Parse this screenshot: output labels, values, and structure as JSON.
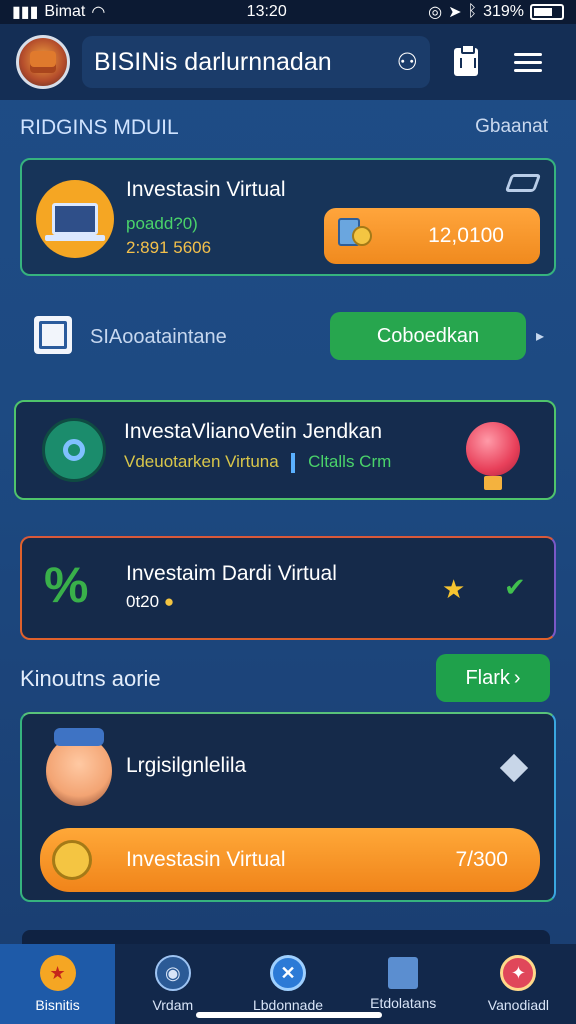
{
  "status_bar": {
    "carrier": "Bimat",
    "time": "13:20",
    "battery": "319%"
  },
  "header": {
    "title": "BISINis darlurnnadan"
  },
  "section_title": {
    "left": "RIDGINS MDUIL",
    "right": "Gbaanat"
  },
  "card1": {
    "title": "Investasin Virtual",
    "sub1": "poadd?0)",
    "sub2": "2:891 5606",
    "button_value": "12,0100"
  },
  "row2": {
    "label": "SIAooataintane",
    "button": "Coboedkan"
  },
  "card2": {
    "title": "InvestaVlianoVetin Jendkan",
    "sub_left": "Vdeuotarken Virtuna",
    "sub_right": "Cltalls Crm"
  },
  "card3": {
    "title": "Investaim Dardi Virtual",
    "sub": "0t20"
  },
  "section2": {
    "title": "Kinoutns aorie",
    "button": "Flark"
  },
  "card4": {
    "title": "Lrgisilgnlelila",
    "button_label": "Investasin Virtual",
    "button_value": "7/300"
  },
  "bottom_nav": [
    {
      "label": "Bisnitis"
    },
    {
      "label": "Vrdam"
    },
    {
      "label": "Lbdonnade"
    },
    {
      "label": "Etdolatans"
    },
    {
      "label": "Vanodiadl"
    }
  ],
  "colors": {
    "accent_orange": "#f5a623",
    "accent_green": "#27a64e",
    "background": "#1f4c86"
  }
}
